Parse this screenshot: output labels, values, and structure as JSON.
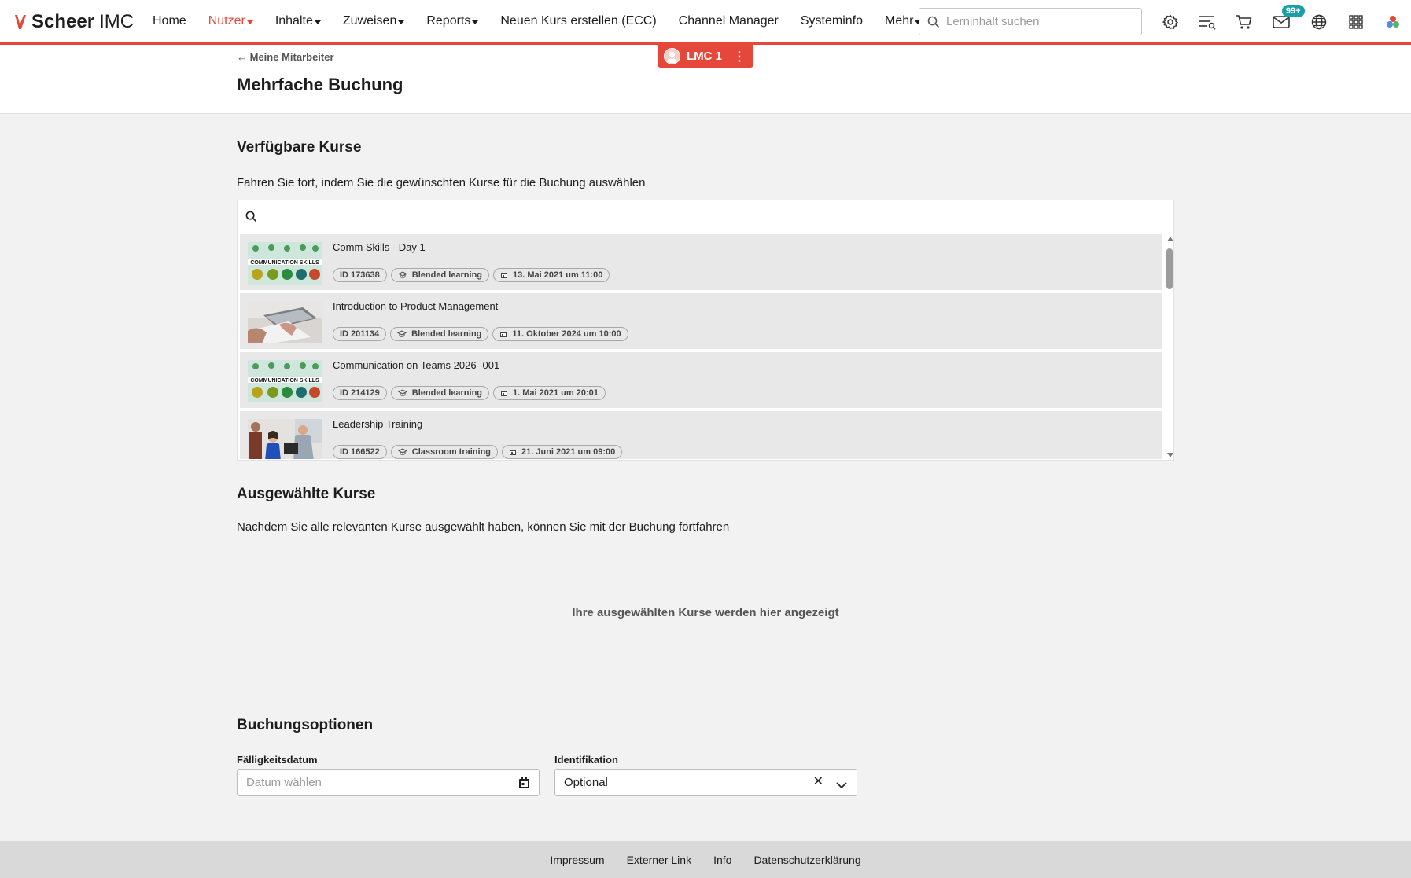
{
  "app": {
    "brand": "Scheer",
    "brand_suffix": "IMC",
    "accent_color": "#e5483a",
    "badge_color": "#1a9ea8"
  },
  "nav": {
    "items": [
      {
        "label": "Home",
        "dropdown": false,
        "active": false
      },
      {
        "label": "Nutzer",
        "dropdown": true,
        "active": true
      },
      {
        "label": "Inhalte",
        "dropdown": true,
        "active": false
      },
      {
        "label": "Zuweisen",
        "dropdown": true,
        "active": false
      },
      {
        "label": "Reports",
        "dropdown": true,
        "active": false
      },
      {
        "label": "Neuen Kurs erstellen (ECC)",
        "dropdown": false,
        "active": false
      },
      {
        "label": "Channel Manager",
        "dropdown": false,
        "active": false
      },
      {
        "label": "Systeminfo",
        "dropdown": false,
        "active": false
      },
      {
        "label": "Mehr",
        "dropdown": true,
        "active": false
      }
    ]
  },
  "search": {
    "placeholder": "Lerninhalt suchen"
  },
  "toolbar": {
    "icons": [
      "gear-icon",
      "worklist-icon",
      "cart-icon",
      "mail-icon",
      "globe-icon",
      "apps-grid-icon",
      "brand-logo-icon"
    ],
    "mail_badge": "99+"
  },
  "user_tab": {
    "label": "LMC 1",
    "menu_icon": "kebab-menu-icon"
  },
  "header": {
    "back_label": "← Meine Mitarbeiter",
    "title": "Mehrfache Buchung"
  },
  "available": {
    "title": "Verfügbare Kurse",
    "description": "Fahren Sie fort, indem Sie die gewünschten Kurse für die Buchung auswählen",
    "courses": [
      {
        "name": "Comm Skills - Day 1",
        "id": "ID 173638",
        "type": "Blended learning",
        "date": "13. Mai 2021 um 11:00",
        "thumb": "communication-skills"
      },
      {
        "name": "Introduction to Product Management",
        "id": "ID 201134",
        "type": "Blended learning",
        "date": "11. Oktober 2024 um 10:00",
        "thumb": "laptop-desk"
      },
      {
        "name": "Communication on Teams 2026 -001",
        "id": "ID 214129",
        "type": "Blended learning",
        "date": "1. Mai 2021 um 20:01",
        "thumb": "communication-skills"
      },
      {
        "name": "Leadership Training",
        "id": "ID 166522",
        "type": "Classroom training",
        "date": "21. Juni 2021 um 09:00",
        "thumb": "office-people"
      }
    ]
  },
  "selected": {
    "title": "Ausgewählte Kurse",
    "description": "Nachdem Sie alle relevanten Kurse ausgewählt haben, können Sie mit der Buchung fortfahren",
    "empty_text": "Ihre ausgewählten Kurse werden hier angezeigt"
  },
  "options": {
    "title": "Buchungsoptionen",
    "due_date": {
      "label": "Fälligkeitsdatum",
      "placeholder": "Datum wählen"
    },
    "identification": {
      "label": "Identifikation",
      "value": "Optional"
    }
  },
  "footer": {
    "links": [
      "Impressum",
      "Externer Link",
      "Info",
      "Datenschutzerklärung"
    ]
  }
}
